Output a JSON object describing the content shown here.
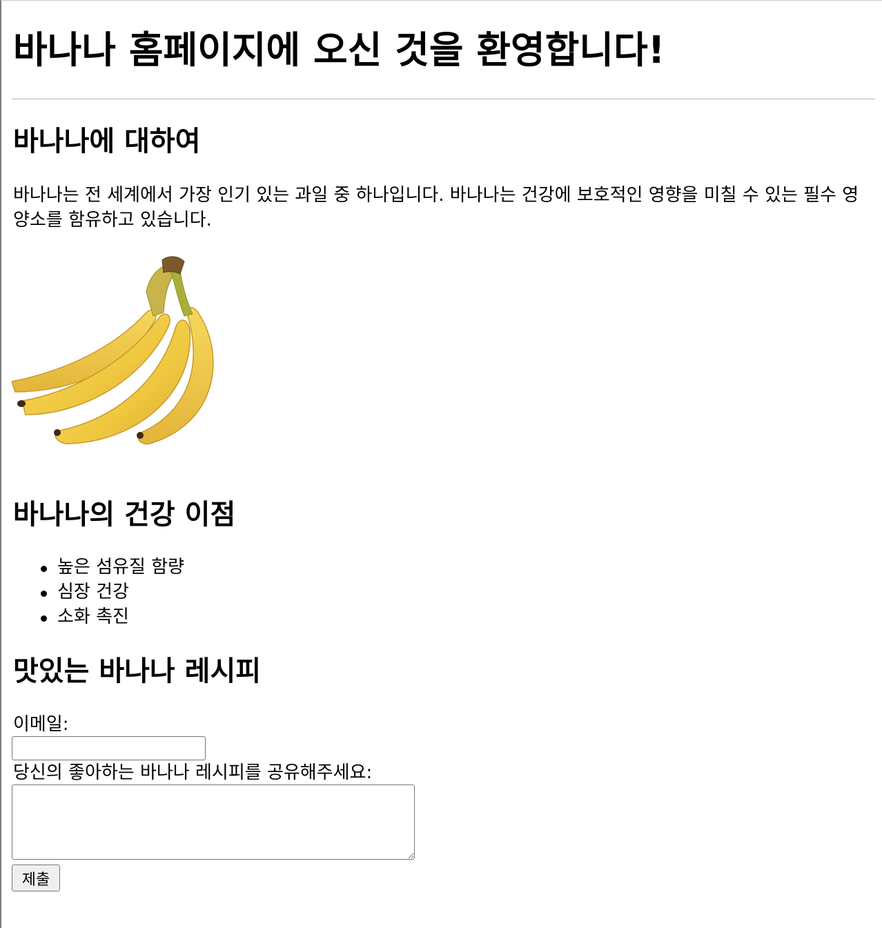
{
  "header": {
    "title": "바나나 홈페이지에 오신 것을 환영합니다!"
  },
  "about": {
    "heading": "바나나에 대하여",
    "paragraph": "바나나는 전 세계에서 가장 인기 있는 과일 중 하나입니다. 바나나는 건강에 보호적인 영향을 미칠 수 있는 필수 영양소를 함유하고 있습니다."
  },
  "health": {
    "heading": "바나나의 건강 이점",
    "benefits": [
      "높은 섬유질 함량",
      "심장 건강",
      "소화 촉진"
    ]
  },
  "recipes": {
    "heading": "맛있는 바나나 레시피",
    "email_label": "이메일:",
    "email_value": "",
    "recipe_label": "당신의 좋아하는 바나나 레시피를 공유해주세요:",
    "recipe_value": "",
    "submit_label": "제출"
  },
  "colors": {
    "banana_yellow": "#f2cd4a",
    "banana_shadow": "#d9a82e",
    "stem_brown": "#7a5a2a",
    "button_bg": "#efefef",
    "border_gray": "#767676"
  }
}
